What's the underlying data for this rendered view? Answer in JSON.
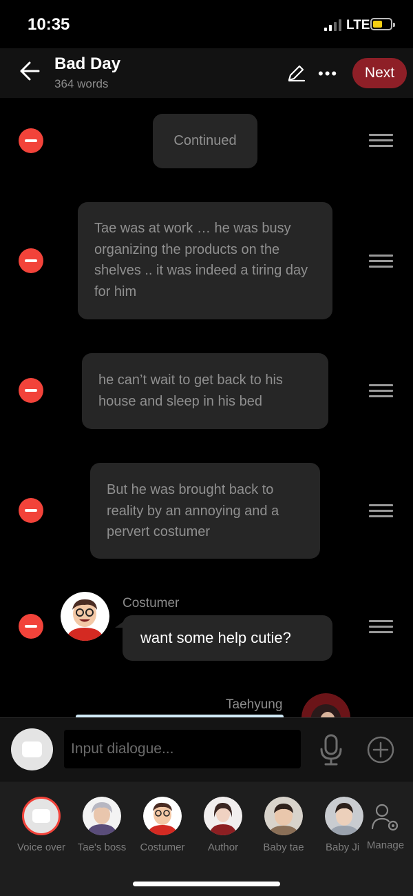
{
  "status": {
    "time": "10:35",
    "network": "LTE"
  },
  "header": {
    "title": "Bad Day",
    "word_count": "364 words",
    "next_label": "Next",
    "icons": [
      "back-arrow-icon",
      "pencil-icon",
      "more-icon"
    ]
  },
  "dialogue": [
    {
      "type": "narration",
      "text": "Continued"
    },
    {
      "type": "narration",
      "text": "Tae was at work … he was busy organizing the products on the shelves .. it was indeed a tiring day for him"
    },
    {
      "type": "narration",
      "text": "he can’t wait to get back to his house and sleep in his bed"
    },
    {
      "type": "narration",
      "text": "But he was brought back to reality by an annoying and a pervert costumer"
    },
    {
      "type": "speech",
      "speaker": "Costumer",
      "text": "want some help cutie?"
    },
    {
      "type": "speech",
      "speaker": "Taehyung",
      "text": ""
    }
  ],
  "composer": {
    "placeholder": "Input dialogue..."
  },
  "characters": [
    {
      "name": "Voice over",
      "selected": true
    },
    {
      "name": "Tae's boss"
    },
    {
      "name": "Costumer"
    },
    {
      "name": "Author"
    },
    {
      "name": "Baby tae"
    },
    {
      "name": "Baby Ji"
    },
    {
      "name": "Manage"
    }
  ],
  "colors": {
    "accent": "#8e1f27",
    "delete": "#f2433a",
    "bubble": "#262626",
    "battery": "#f5cf12"
  }
}
